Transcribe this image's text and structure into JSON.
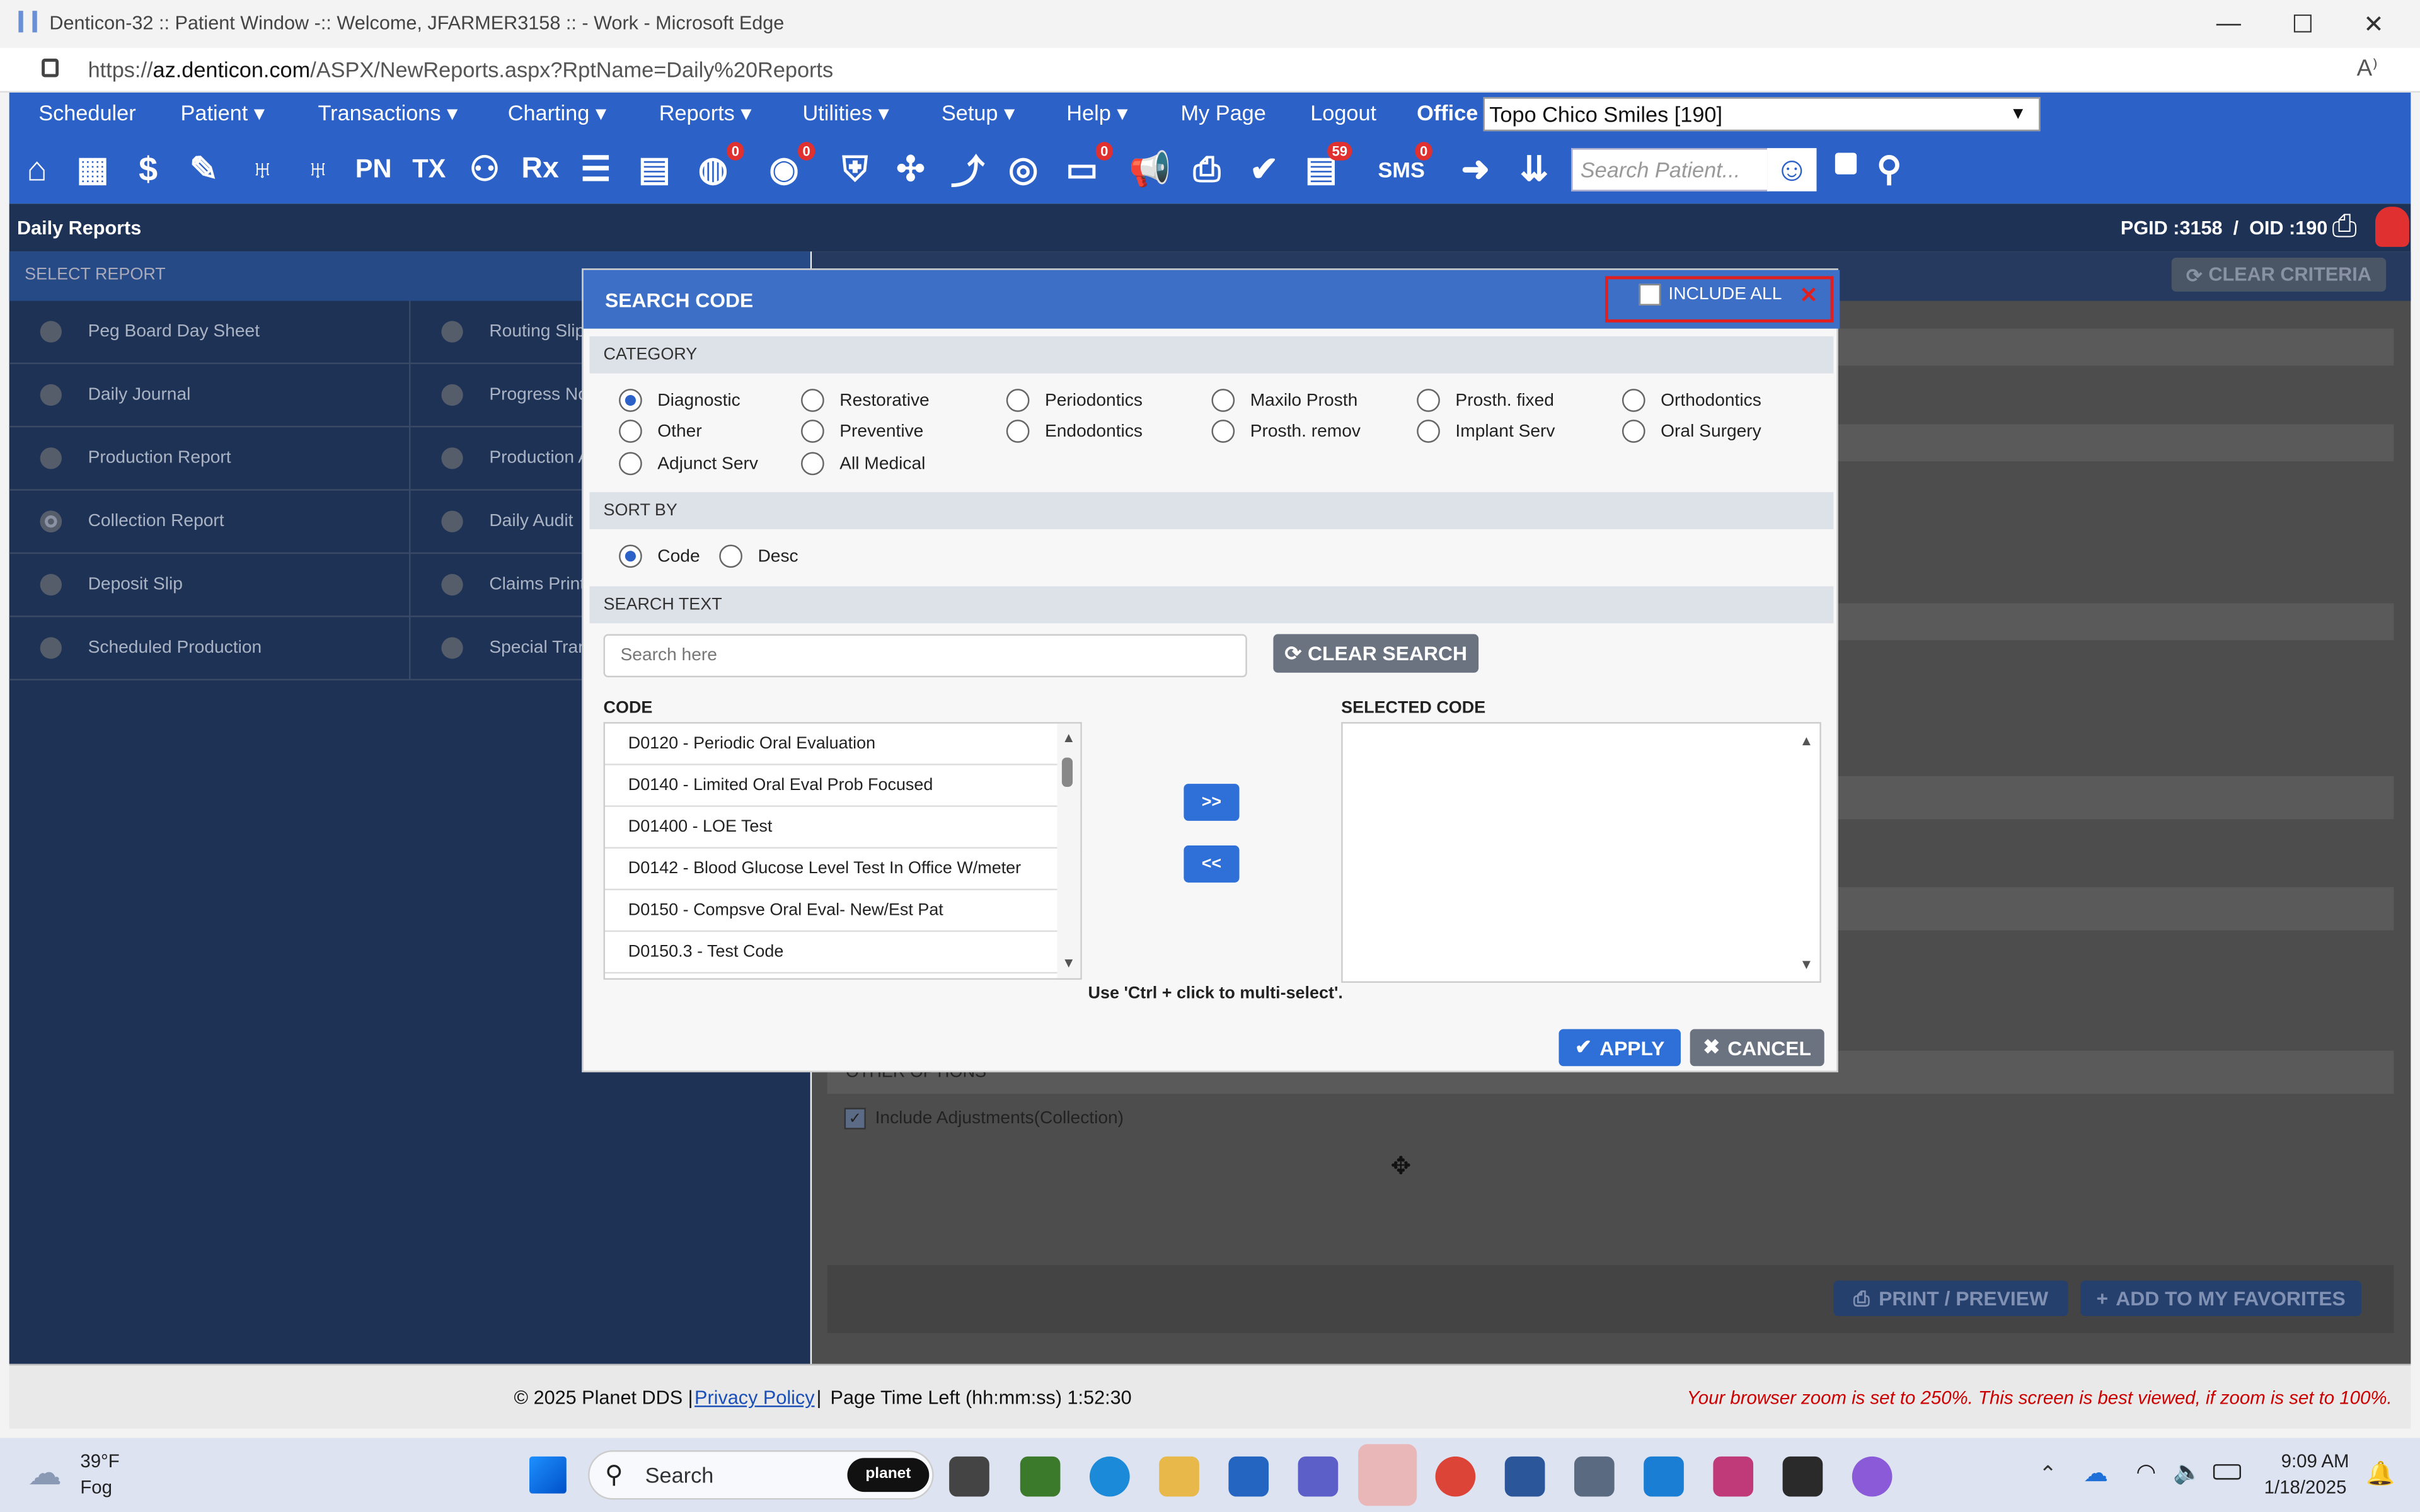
{
  "window": {
    "title": "Denticon-32 :: Patient Window -:: Welcome, JFARMER3158 :: - Work - Microsoft Edge"
  },
  "browser": {
    "url_prefix": "https://",
    "url_domain": "az.denticon.com",
    "url_path": "/ASPX/NewReports.aspx?RptName=Daily%20Reports"
  },
  "menu": {
    "items": [
      "Scheduler",
      "Patient ▾",
      "Transactions ▾",
      "Charting ▾",
      "Reports ▾",
      "Utilities ▾",
      "Setup ▾",
      "Help ▾",
      "My Page",
      "Logout"
    ],
    "office_label": "Office",
    "office_value": "Topo Chico Smiles [190]"
  },
  "toolbar": {
    "badges": {
      "globe": "0",
      "support": "0",
      "messages": "0",
      "tasks": "59",
      "sms": "0"
    },
    "sms_label": "SMS",
    "pn_label": "PN",
    "tx_label": "TX",
    "rx_label": "Rx",
    "search_placeholder": "Search Patient..."
  },
  "header": {
    "title": "Daily Reports",
    "ids": "PGID :3158  /  OID :190"
  },
  "left": {
    "select_report": "SELECT REPORT",
    "col1": [
      "Peg Board Day Sheet",
      "Daily Journal",
      "Production Report",
      "Collection Report",
      "Deposit Slip",
      "Scheduled Production"
    ],
    "col2": [
      "Routing Slip",
      "Progress Not",
      "Production A",
      "Daily Audit",
      "Claims Printe",
      "Special Trans"
    ]
  },
  "right": {
    "clear_criteria": "CLEAR CRITERIA",
    "other_options": "OTHER OPTIONS",
    "include_adjustments": "Include Adjustments(Collection)",
    "print_preview": "PRINT / PREVIEW",
    "add_favorites": "ADD TO MY FAVORITES"
  },
  "modal": {
    "title": "SEARCH CODE",
    "include_all": "INCLUDE ALL",
    "category_label": "CATEGORY",
    "categories": [
      [
        "Diagnostic",
        "Restorative",
        "Periodontics",
        "Maxilo Prosth",
        "Prosth. fixed",
        "Orthodontics"
      ],
      [
        "Other",
        "Preventive",
        "Endodontics",
        "Prosth. remov",
        "Implant Serv",
        "Oral Surgery"
      ],
      [
        "Adjunct Serv",
        "All Medical"
      ]
    ],
    "selected_category": "Diagnostic",
    "sort_label": "SORT BY",
    "sort_options": [
      "Code",
      "Desc"
    ],
    "selected_sort": "Code",
    "search_text_label": "SEARCH TEXT",
    "search_placeholder": "Search here",
    "clear_search": "CLEAR SEARCH",
    "code_label": "CODE",
    "codes": [
      "D0120 - Periodic Oral Evaluation",
      "D0140 - Limited Oral Eval Prob Focused",
      "D01400 - LOE Test",
      "D0142 - Blood Glucose Level Test In Office W/meter",
      "D0150 - Compsve Oral Eval- New/Est Pat",
      "D0150.3 - Test Code"
    ],
    "add_btn": ">>",
    "remove_btn": "<<",
    "selected_label": "SELECTED CODE",
    "hint": "Use 'Ctrl + click to multi-select'.",
    "apply": "APPLY",
    "cancel": "CANCEL"
  },
  "footer": {
    "copyright": "© 2025 Planet DDS |",
    "privacy": "Privacy Policy",
    "sep": "|",
    "time_left": "Page Time Left (hh:mm:ss) 1:52:30",
    "zoom_warning": "Your browser zoom is set to 250%. This screen is best viewed, if zoom is set to 100%."
  },
  "taskbar": {
    "temp": "39°F",
    "weather": "Fog",
    "search": "Search",
    "planet": "planet",
    "time": "9:09 AM",
    "date": "1/18/2025"
  },
  "colors": {
    "menu_blue": "#2c61c8",
    "modal_header": "#3d6fc7",
    "dark_panel": "#1e3255",
    "warning_red": "#cc0000"
  }
}
